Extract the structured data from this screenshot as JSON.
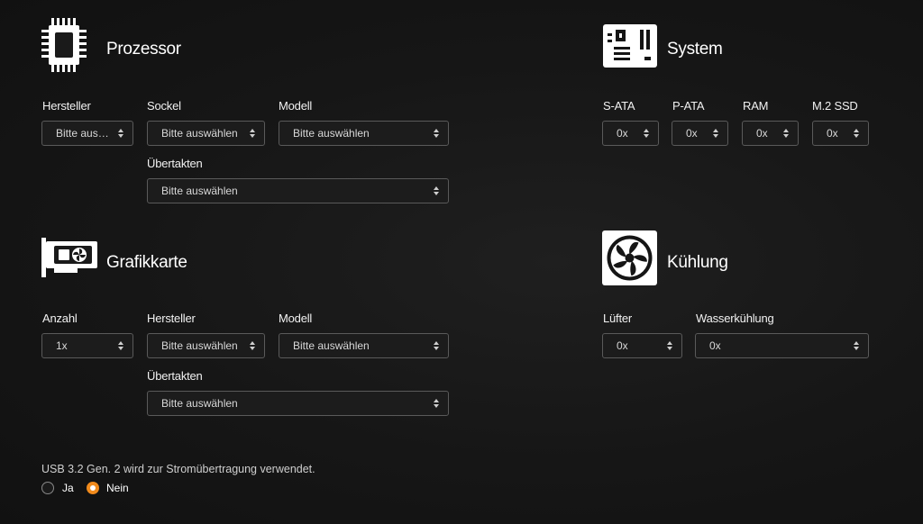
{
  "processor": {
    "title": "Prozessor",
    "icon": "cpu-icon",
    "labels": {
      "manufacturer": "Hersteller",
      "socket": "Sockel",
      "model": "Modell",
      "overclock": "Übertakten"
    },
    "values": {
      "manufacturer": "Bitte aus…",
      "socket": "Bitte auswählen",
      "model": "Bitte auswählen",
      "overclock": "Bitte auswählen"
    }
  },
  "system": {
    "title": "System",
    "icon": "motherboard-icon",
    "labels": {
      "sata": "S-ATA",
      "pata": "P-ATA",
      "ram": "RAM",
      "m2": "M.2 SSD"
    },
    "values": {
      "sata": "0x",
      "pata": "0x",
      "ram": "0x",
      "m2": "0x"
    }
  },
  "graphics": {
    "title": "Grafikkarte",
    "icon": "graphics-card-icon",
    "labels": {
      "count": "Anzahl",
      "manufacturer": "Hersteller",
      "model": "Modell",
      "overclock": "Übertakten"
    },
    "values": {
      "count": "1x",
      "manufacturer": "Bitte auswählen",
      "model": "Bitte auswählen",
      "overclock": "Bitte auswählen"
    }
  },
  "cooling": {
    "title": "Kühlung",
    "icon": "fan-icon",
    "labels": {
      "fans": "Lüfter",
      "water": "Wasserkühlung"
    },
    "values": {
      "fans": "0x",
      "water": "0x"
    }
  },
  "usb": {
    "question": "USB 3.2 Gen. 2 wird zur Stromübertragung verwendet.",
    "options": [
      {
        "label": "Ja",
        "selected": false
      },
      {
        "label": "Nein",
        "selected": true
      }
    ],
    "accent": "#f08a1c"
  }
}
